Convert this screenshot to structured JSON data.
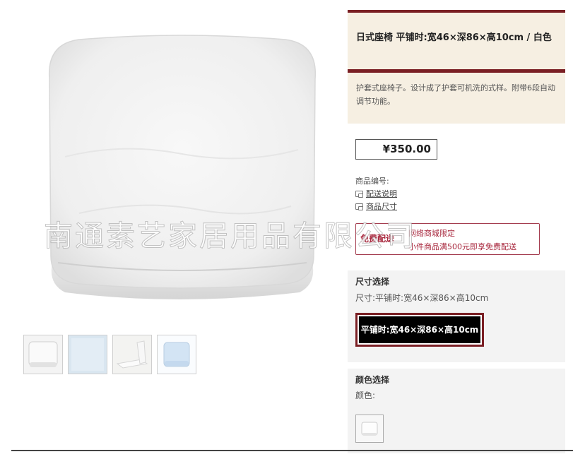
{
  "product": {
    "title": "日式座椅 平铺时:宽46×深86×高10cm / 白色",
    "description": "护套式座椅子。设计成了护套可机洗的式样。附带6段自动调节功能。",
    "price": "¥350.00",
    "product_code_label": "商品编号:",
    "links": [
      "配送说明",
      "商品尺寸"
    ]
  },
  "shipping_badge": {
    "label": "免费配送",
    "line1": "网络商城限定",
    "line2": "小件商品满500元即享免费配送"
  },
  "size_section": {
    "heading": "尺寸选择",
    "current": "尺寸:平铺时:宽46×深86×高10cm",
    "option": "平铺时:宽46×深86×高10cm"
  },
  "color_section": {
    "heading": "颜色选择",
    "current": "颜色:"
  },
  "watermark": "南通素艺家居用品有限公司",
  "colors": {
    "accent": "#7a1f24",
    "panel_bg": "#f6efe2",
    "badge": "#a8273d"
  }
}
